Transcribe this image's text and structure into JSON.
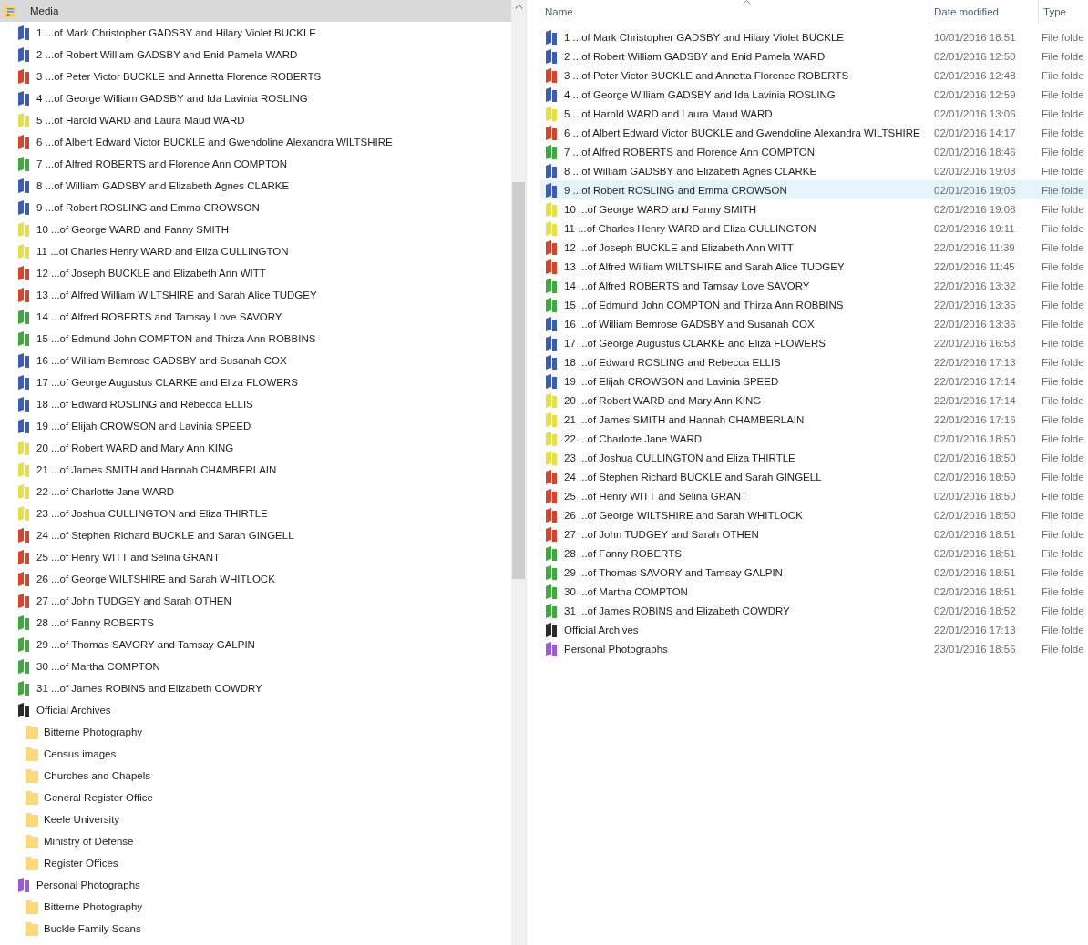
{
  "nav_tree": {
    "label": "Media",
    "selected": true,
    "children": [
      {
        "label": "1 ...of Mark Christopher GADSBY and Hilary Violet BUCKLE",
        "color": "#3b5cb8",
        "selected": false
      },
      {
        "label": "2 ...of Robert William GADSBY and Enid Pamela WARD",
        "color": "#3b5cb8",
        "selected": false
      },
      {
        "label": "3 ...of Peter Victor BUCKLE and Annetta Florence ROBERTS",
        "color": "#d8432c",
        "selected": false
      },
      {
        "label": "4 ...of George William GADSBY and Ida Lavinia ROSLING",
        "color": "#3b5cb8",
        "selected": false
      },
      {
        "label": "5 ...of Harold WARD and Laura Maud WARD",
        "color": "#e6e048",
        "selected": false
      },
      {
        "label": "6 ...of Albert Edward Victor BUCKLE and Gwendoline Alexandra WILTSHIRE",
        "color": "#d8432c",
        "selected": false
      },
      {
        "label": "7 ...of Alfred ROBERTS and Florence Ann COMPTON",
        "color": "#3fa83f",
        "selected": false
      },
      {
        "label": "8 ...of William GADSBY and Elizabeth Agnes CLARKE",
        "color": "#3b5cb8",
        "selected": false
      },
      {
        "label": "9 ...of Robert ROSLING and Emma CROWSON",
        "color": "#3b5cb8",
        "selected": false
      },
      {
        "label": "10 ...of George WARD and Fanny SMITH",
        "color": "#e6e048",
        "selected": false
      },
      {
        "label": "11 ...of Charles Henry WARD and Eliza CULLINGTON",
        "color": "#e6e048",
        "selected": false
      },
      {
        "label": "12 ...of Joseph BUCKLE and Elizabeth Ann WITT",
        "color": "#d8432c",
        "selected": false
      },
      {
        "label": "13 ...of Alfred William WILTSHIRE and Sarah Alice TUDGEY",
        "color": "#d8432c",
        "selected": false
      },
      {
        "label": "14 ...of Alfred ROBERTS and Tamsay Love SAVORY",
        "color": "#3fa83f",
        "selected": false
      },
      {
        "label": "15 ...of Edmund John COMPTON and Thirza Ann ROBBINS",
        "color": "#3fa83f",
        "selected": false
      },
      {
        "label": "16 ...of William Bemrose GADSBY and Susanah COX",
        "color": "#3b5cb8",
        "selected": false
      },
      {
        "label": "17 ...of George Augustus CLARKE and Eliza FLOWERS",
        "color": "#3b5cb8",
        "selected": false
      },
      {
        "label": "18 ...of Edward ROSLING and Rebecca ELLIS",
        "color": "#3b5cb8",
        "selected": false
      },
      {
        "label": "19 ...of Elijah CROWSON and Lavinia SPEED",
        "color": "#3b5cb8",
        "selected": false
      },
      {
        "label": "20 ...of Robert WARD and Mary Ann KING",
        "color": "#e6e048",
        "selected": false
      },
      {
        "label": "21 ...of James SMITH and Hannah CHAMBERLAIN",
        "color": "#e6e048",
        "selected": false
      },
      {
        "label": "22 ...of Charlotte Jane WARD",
        "color": "#e6e048",
        "selected": false
      },
      {
        "label": "23 ...of Joshua CULLINGTON and Eliza THIRTLE",
        "color": "#e6e048",
        "selected": false
      },
      {
        "label": "24 ...of Stephen Richard BUCKLE and Sarah GINGELL",
        "color": "#d8432c",
        "selected": false
      },
      {
        "label": "25 ...of Henry WITT and Selina GRANT",
        "color": "#d8432c",
        "selected": false
      },
      {
        "label": "26 ...of George WILTSHIRE and Sarah WHITLOCK",
        "color": "#d8432c",
        "selected": false
      },
      {
        "label": "27 ...of John TUDGEY and Sarah OTHEN",
        "color": "#d8432c",
        "selected": false
      },
      {
        "label": "28 ...of Fanny ROBERTS",
        "color": "#3fa83f",
        "selected": false
      },
      {
        "label": "29 ...of Thomas SAVORY and Tamsay GALPIN",
        "color": "#3fa83f",
        "selected": false
      },
      {
        "label": "30 ...of Martha COMPTON",
        "color": "#3fa83f",
        "selected": false
      },
      {
        "label": "31 ...of James ROBINS and Elizabeth COWDRY",
        "color": "#3fa83f",
        "selected": false
      },
      {
        "label": "Official Archives",
        "color": "#2b2b2b",
        "selected": false,
        "children": [
          {
            "label": "Bitterne Photography",
            "color": "#fbd97a",
            "selected": false
          },
          {
            "label": "Census images",
            "color": "#fbd97a",
            "selected": false
          },
          {
            "label": "Churches and Chapels",
            "color": "#fbd97a",
            "selected": false
          },
          {
            "label": "General Register Office",
            "color": "#fbd97a",
            "selected": false
          },
          {
            "label": "Keele University",
            "color": "#fbd97a",
            "selected": false
          },
          {
            "label": "Ministry of Defense",
            "color": "#fbd97a",
            "selected": false
          },
          {
            "label": "Register Offices",
            "color": "#fbd97a",
            "selected": false
          }
        ]
      },
      {
        "label": "Personal Photographs",
        "color": "#9b5bd8",
        "selected": false,
        "children": [
          {
            "label": "Bitterne Photography",
            "color": "#fbd97a",
            "selected": false
          },
          {
            "label": "Buckle Family Scans",
            "color": "#fbd97a",
            "selected": false
          }
        ]
      }
    ]
  },
  "file_list": {
    "columns": [
      "Name",
      "Date modified",
      "Type"
    ],
    "rows": [
      {
        "name": "1 ...of Mark Christopher GADSBY and Hilary Violet BUCKLE",
        "date": "10/01/2016 18:51",
        "type": "File folde",
        "color": "#3b5cb8",
        "selected": false
      },
      {
        "name": "2 ...of Robert William GADSBY and Enid Pamela WARD",
        "date": "02/01/2016 12:50",
        "type": "File folde",
        "color": "#3b5cb8",
        "selected": false
      },
      {
        "name": "3 ...of Peter Victor BUCKLE and Annetta Florence ROBERTS",
        "date": "02/01/2016 12:48",
        "type": "File folde",
        "color": "#d8432c",
        "selected": false
      },
      {
        "name": "4 ...of George William GADSBY and Ida Lavinia ROSLING",
        "date": "02/01/2016 12:59",
        "type": "File folde",
        "color": "#3b5cb8",
        "selected": false
      },
      {
        "name": "5 ...of Harold WARD and Laura Maud WARD",
        "date": "02/01/2016 13:06",
        "type": "File folde",
        "color": "#e6e048",
        "selected": false
      },
      {
        "name": "6 ...of Albert Edward Victor BUCKLE and Gwendoline Alexandra WILTSHIRE",
        "date": "02/01/2016 14:17",
        "type": "File folde",
        "color": "#d8432c",
        "selected": false
      },
      {
        "name": "7 ...of Alfred ROBERTS and Florence Ann COMPTON",
        "date": "02/01/2016 18:46",
        "type": "File folde",
        "color": "#3fa83f",
        "selected": false
      },
      {
        "name": "8 ...of William GADSBY and Elizabeth Agnes CLARKE",
        "date": "02/01/2016 19:03",
        "type": "File folde",
        "color": "#3b5cb8",
        "selected": false
      },
      {
        "name": "9 ...of Robert ROSLING and Emma CROWSON",
        "date": "02/01/2016 19:05",
        "type": "File folde",
        "color": "#3b5cb8",
        "selected": true
      },
      {
        "name": "10 ...of George WARD and Fanny SMITH",
        "date": "02/01/2016 19:08",
        "type": "File folde",
        "color": "#e6e048",
        "selected": false
      },
      {
        "name": "11 ...of Charles Henry WARD and Eliza CULLINGTON",
        "date": "02/01/2016 19:11",
        "type": "File folde",
        "color": "#e6e048",
        "selected": false
      },
      {
        "name": "12 ...of Joseph BUCKLE and Elizabeth Ann WITT",
        "date": "22/01/2016 11:39",
        "type": "File folde",
        "color": "#d8432c",
        "selected": false
      },
      {
        "name": "13 ...of Alfred William WILTSHIRE and Sarah Alice TUDGEY",
        "date": "22/01/2016 11:45",
        "type": "File folde",
        "color": "#d8432c",
        "selected": false
      },
      {
        "name": "14 ...of Alfred ROBERTS and Tamsay Love SAVORY",
        "date": "22/01/2016 13:32",
        "type": "File folde",
        "color": "#3fa83f",
        "selected": false
      },
      {
        "name": "15 ...of Edmund John COMPTON and Thirza Ann ROBBINS",
        "date": "22/01/2016 13:35",
        "type": "File folde",
        "color": "#3fa83f",
        "selected": false
      },
      {
        "name": "16 ...of William Bemrose GADSBY and Susanah COX",
        "date": "22/01/2016 13:36",
        "type": "File folde",
        "color": "#3b5cb8",
        "selected": false
      },
      {
        "name": "17 ...of George Augustus CLARKE and Eliza FLOWERS",
        "date": "22/01/2016 16:53",
        "type": "File folde",
        "color": "#3b5cb8",
        "selected": false
      },
      {
        "name": "18 ...of Edward ROSLING and Rebecca ELLIS",
        "date": "22/01/2016 17:13",
        "type": "File folde",
        "color": "#3b5cb8",
        "selected": false
      },
      {
        "name": "19 ...of Elijah CROWSON and Lavinia SPEED",
        "date": "22/01/2016 17:14",
        "type": "File folde",
        "color": "#3b5cb8",
        "selected": false
      },
      {
        "name": "20 ...of Robert WARD and Mary Ann KING",
        "date": "22/01/2016 17:14",
        "type": "File folde",
        "color": "#e6e048",
        "selected": false
      },
      {
        "name": "21 ...of James SMITH and Hannah CHAMBERLAIN",
        "date": "22/01/2016 17:16",
        "type": "File folde",
        "color": "#e6e048",
        "selected": false
      },
      {
        "name": "22 ...of Charlotte Jane WARD",
        "date": "02/01/2016 18:50",
        "type": "File folde",
        "color": "#e6e048",
        "selected": false
      },
      {
        "name": "23 ...of Joshua CULLINGTON and Eliza THIRTLE",
        "date": "02/01/2016 18:50",
        "type": "File folde",
        "color": "#e6e048",
        "selected": false
      },
      {
        "name": "24 ...of Stephen Richard BUCKLE and Sarah GINGELL",
        "date": "02/01/2016 18:50",
        "type": "File folde",
        "color": "#d8432c",
        "selected": false
      },
      {
        "name": "25 ...of Henry WITT and Selina GRANT",
        "date": "02/01/2016 18:50",
        "type": "File folde",
        "color": "#d8432c",
        "selected": false
      },
      {
        "name": "26 ...of George WILTSHIRE and Sarah WHITLOCK",
        "date": "02/01/2016 18:50",
        "type": "File folde",
        "color": "#d8432c",
        "selected": false
      },
      {
        "name": "27 ...of John TUDGEY and Sarah OTHEN",
        "date": "02/01/2016 18:51",
        "type": "File folde",
        "color": "#d8432c",
        "selected": false
      },
      {
        "name": "28 ...of Fanny ROBERTS",
        "date": "02/01/2016 18:51",
        "type": "File folde",
        "color": "#3fa83f",
        "selected": false
      },
      {
        "name": "29 ...of Thomas SAVORY and Tamsay GALPIN",
        "date": "02/01/2016 18:51",
        "type": "File folde",
        "color": "#3fa83f",
        "selected": false
      },
      {
        "name": "30 ...of Martha COMPTON",
        "date": "02/01/2016 18:51",
        "type": "File folde",
        "color": "#3fa83f",
        "selected": false
      },
      {
        "name": "31 ...of James ROBINS and Elizabeth COWDRY",
        "date": "02/01/2016 18:52",
        "type": "File folde",
        "color": "#3fa83f",
        "selected": false
      },
      {
        "name": "Official Archives",
        "date": "22/01/2016 17:13",
        "type": "File folde",
        "color": "#2b2b2b",
        "selected": false
      },
      {
        "name": "Personal Photographs",
        "date": "23/01/2016 18:56",
        "type": "File folde",
        "color": "#9b5bd8",
        "selected": false
      }
    ]
  }
}
